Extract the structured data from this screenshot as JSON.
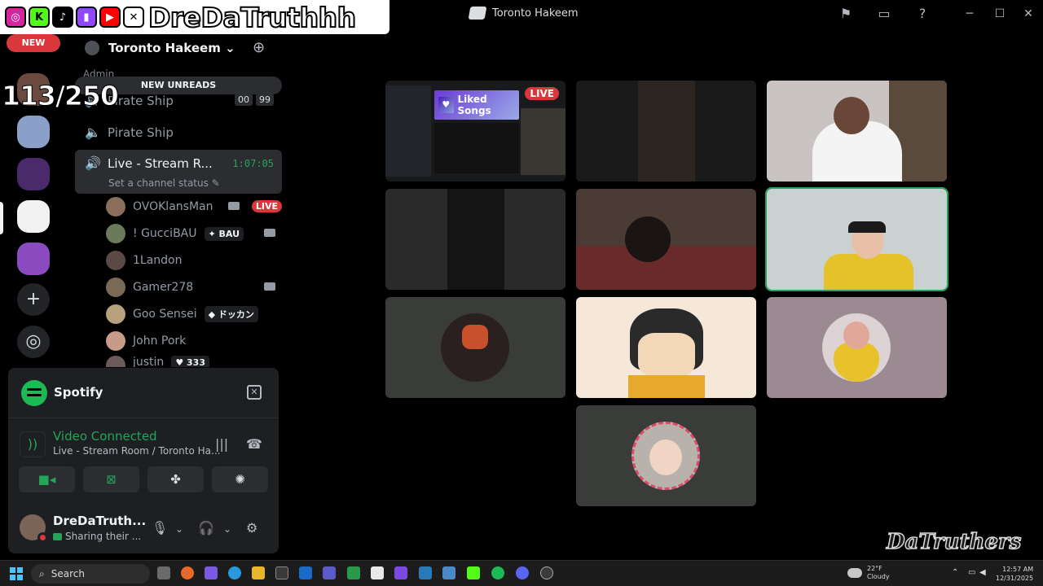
{
  "window": {
    "title": "Toronto Hakeem"
  },
  "overlay": {
    "handle": "DreDaTruthhh",
    "viewer_count": "113/250",
    "watermark": "DaTruthers"
  },
  "rail": {
    "new_badge": "NEW"
  },
  "server": {
    "name": "Toronto Hakeem",
    "category": "Admin",
    "new_unreads": "NEW UNREADS"
  },
  "channels": [
    {
      "name": "Pirate Ship",
      "badges": [
        "00",
        "99"
      ]
    },
    {
      "name": "Pirate Ship"
    },
    {
      "name": "Live - Stream R...",
      "timer": "1:07:05",
      "status": "Set a channel status"
    }
  ],
  "voice_users": [
    {
      "name": "OVOKlansMan",
      "live": "LIVE",
      "color": "#8a6d5b"
    },
    {
      "name": "! GucciBAU",
      "tag": "BAU",
      "color": "#6b7a5a"
    },
    {
      "name": "1Landon",
      "color": "#5a4a46"
    },
    {
      "name": "Gamer278",
      "color": "#7a6a55"
    },
    {
      "name": "Goo Sensei",
      "tag": "ドッカン",
      "color": "#b9a07c"
    },
    {
      "name": "John Pork",
      "color": "#c89a8a"
    },
    {
      "name": "justin",
      "tag": "333",
      "color": "#6a5a5a"
    }
  ],
  "activity": {
    "app": "Spotify"
  },
  "voice": {
    "status": "Video Connected",
    "location": "Live - Stream Room / Toronto Ha..."
  },
  "user": {
    "name": "DreDaTruth...",
    "status": "Sharing their ..."
  },
  "stream": {
    "live_label": "LIVE",
    "playlist_title": "Liked Songs"
  },
  "taskbar": {
    "search_label": "Search",
    "temperature": "22°F",
    "condition": "Cloudy",
    "time": "12:57 AM",
    "date": "12/31/2025"
  },
  "colors": {
    "accent_green": "#23a55a",
    "live_red": "#da373c",
    "spotify_green": "#1db954"
  }
}
